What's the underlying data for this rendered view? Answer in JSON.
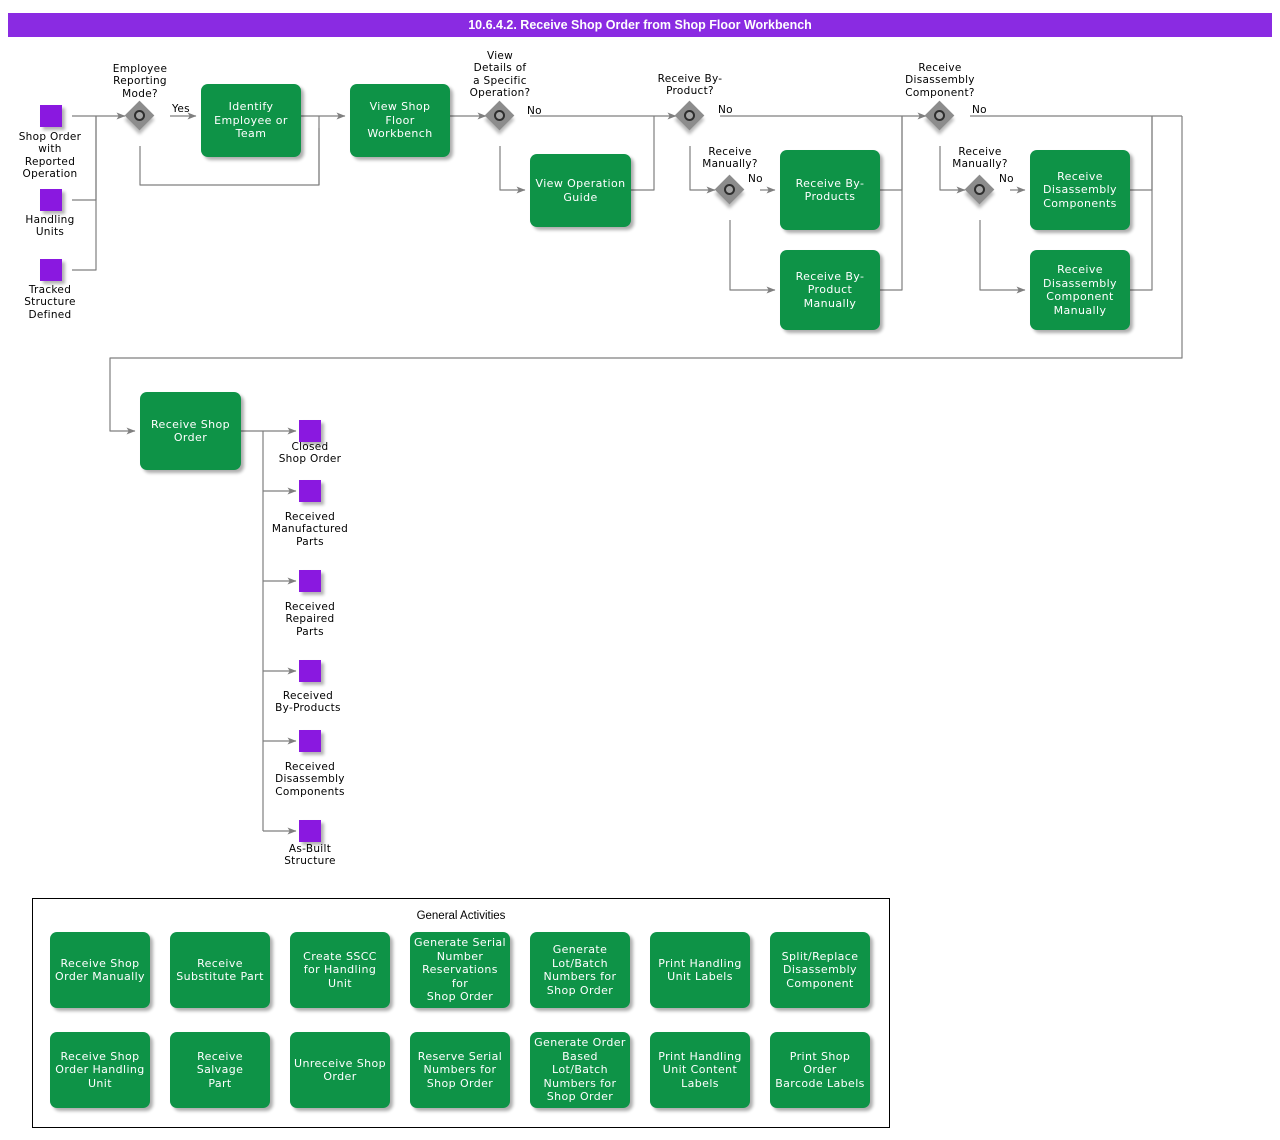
{
  "title": "10.6.4.2. Receive Shop Order from Shop Floor Workbench",
  "colors": {
    "title_bar": "#8A2BE2",
    "activity_green": "#0E9347",
    "data_object_purple": "#8A18E0",
    "gateway_gray": "#8C8C8C",
    "connector_gray": "#808080"
  },
  "inputs": [
    {
      "id": "shop-order-with-reported-operation",
      "label": "Shop Order\nwith\nReported\nOperation"
    },
    {
      "id": "handling-units",
      "label": "Handling\nUnits"
    },
    {
      "id": "tracked-structure-defined",
      "label": "Tracked\nStructure\nDefined"
    }
  ],
  "gateways": [
    {
      "id": "employee-reporting-mode",
      "question": "Employee\nReporting\nMode?",
      "branch_label": "Yes"
    },
    {
      "id": "view-details-of-a-specific-operation",
      "question": "View\nDetails of\na Specific\nOperation?",
      "branch_label": "No"
    },
    {
      "id": "receive-by-product",
      "question": "Receive By-\nProduct?",
      "branch_label": "No"
    },
    {
      "id": "receive-by-product-manually",
      "question": "Receive\nManually?",
      "branch_label": "No"
    },
    {
      "id": "receive-disassembly-component",
      "question": "Receive\nDisassembly\nComponent?",
      "branch_label": "No"
    },
    {
      "id": "receive-disassembly-manually",
      "question": "Receive\nManually?",
      "branch_label": "No"
    }
  ],
  "activities": [
    {
      "id": "identify-employee-or-team",
      "label": "Identify\nEmployee or\nTeam"
    },
    {
      "id": "view-shop-floor-workbench",
      "label": "View Shop Floor\nWorkbench"
    },
    {
      "id": "view-operation-guide",
      "label": "View Operation\nGuide"
    },
    {
      "id": "receive-by-products",
      "label": "Receive By-\nProducts"
    },
    {
      "id": "receive-by-product-manually",
      "label": "Receive By-\nProduct\nManually"
    },
    {
      "id": "receive-disassembly-components",
      "label": "Receive\nDisassembly\nComponents"
    },
    {
      "id": "receive-disassembly-component-manually",
      "label": "Receive\nDisassembly\nComponent\nManually"
    },
    {
      "id": "receive-shop-order",
      "label": "Receive Shop\nOrder"
    }
  ],
  "outputs": [
    {
      "id": "closed-shop-order",
      "label": "Closed\nShop Order"
    },
    {
      "id": "received-manufactured-parts",
      "label": "Received\nManufactured\nParts"
    },
    {
      "id": "received-repaired-parts",
      "label": "Received\nRepaired\nParts"
    },
    {
      "id": "received-by-products",
      "label": "Received\nBy-Products"
    },
    {
      "id": "received-disassembly-components",
      "label": "Received\nDisassembly\nComponents"
    },
    {
      "id": "as-built-structure",
      "label": "As-Built\nStructure"
    }
  ],
  "general_activities": {
    "title": "General Activities",
    "items": [
      {
        "id": "receive-shop-order-manually",
        "label": "Receive Shop\nOrder Manually"
      },
      {
        "id": "receive-substitute-part",
        "label": "Receive\nSubstitute Part"
      },
      {
        "id": "create-sscc-for-handling-unit",
        "label": "Create SSCC\nfor Handling Unit"
      },
      {
        "id": "generate-serial-number-reservations-for-shop-order",
        "label": "Generate Serial\nNumber\nReservations for\nShop Order"
      },
      {
        "id": "generate-lot-batch-numbers-for-shop-order",
        "label": "Generate\nLot/Batch\nNumbers for\nShop Order"
      },
      {
        "id": "print-handling-unit-labels",
        "label": "Print Handling\nUnit Labels"
      },
      {
        "id": "split-replace-disassembly-component",
        "label": "Split/Replace\nDisassembly\nComponent"
      },
      {
        "id": "receive-shop-order-handling-unit",
        "label": "Receive Shop\nOrder Handling\nUnit"
      },
      {
        "id": "receive-salvage-part",
        "label": "Receive Salvage\nPart"
      },
      {
        "id": "unreceive-shop-order",
        "label": "Unreceive Shop\nOrder"
      },
      {
        "id": "reserve-serial-numbers-for-shop-order",
        "label": "Reserve Serial\nNumbers for\nShop Order"
      },
      {
        "id": "generate-order-based-lot-batch-numbers-for-shop-order",
        "label": "Generate Order\nBased Lot/Batch\nNumbers for\nShop Order"
      },
      {
        "id": "print-handling-unit-content-labels",
        "label": "Print Handling\nUnit Content\nLabels"
      },
      {
        "id": "print-shop-order-barcode-labels",
        "label": "Print Shop Order\nBarcode Labels"
      }
    ]
  }
}
